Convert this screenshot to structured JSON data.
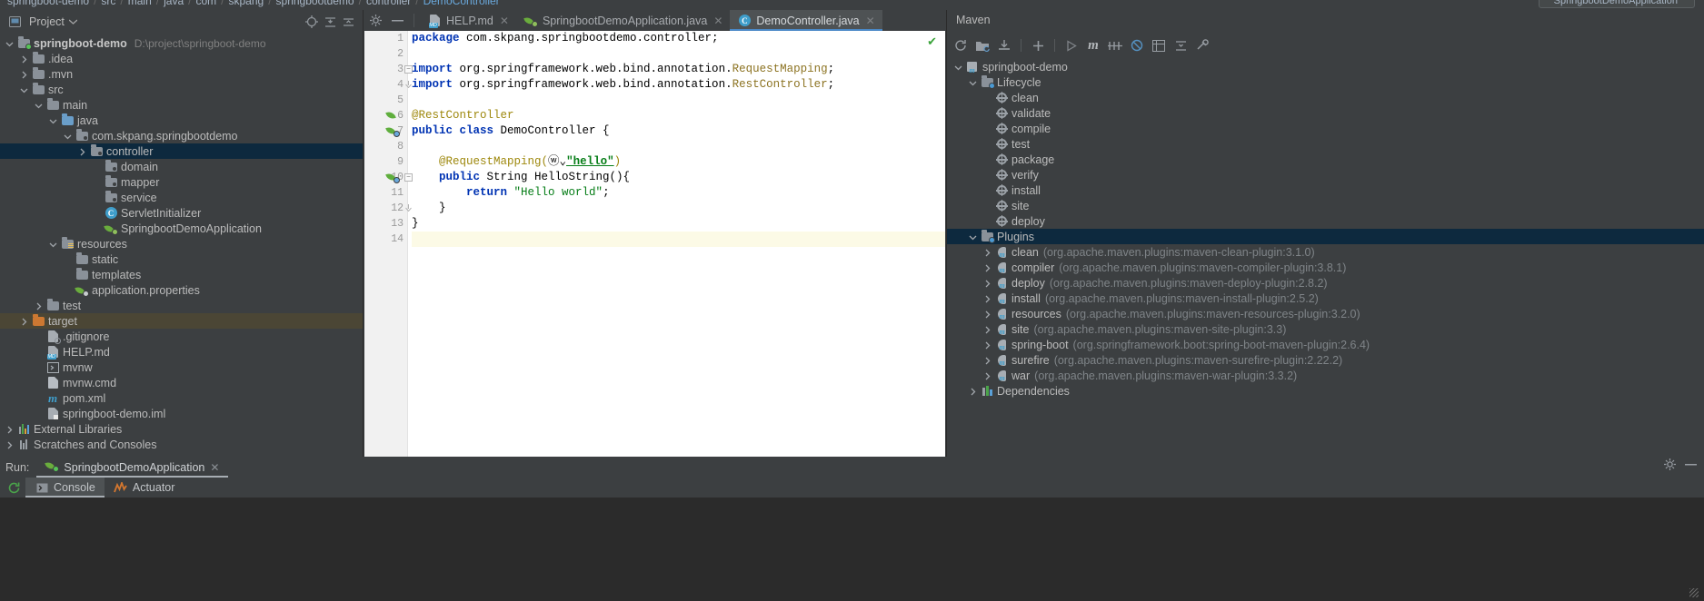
{
  "breadcrumb": {
    "items": [
      "springboot-demo",
      "src",
      "main",
      "java",
      "com",
      "skpang",
      "springbootdemo",
      "controller",
      "DemoController"
    ],
    "separator": "/"
  },
  "top_right": {
    "run_config": "SpringbootDemoApplication"
  },
  "project_panel": {
    "title": "Project",
    "icons": [
      "locate-icon",
      "expand-all-icon",
      "collapse-all-icon",
      "settings-icon",
      "hide-icon"
    ],
    "tree": [
      {
        "label": "springboot-demo",
        "path": "D:\\project\\springboot-demo",
        "depth": 0,
        "arrow": "down",
        "icon": "module-folder-icon",
        "bold": true
      },
      {
        "label": ".idea",
        "depth": 1,
        "arrow": "right",
        "icon": "folder-icon"
      },
      {
        "label": ".mvn",
        "depth": 1,
        "arrow": "right",
        "icon": "folder-icon"
      },
      {
        "label": "src",
        "depth": 1,
        "arrow": "down",
        "icon": "folder-icon"
      },
      {
        "label": "main",
        "depth": 2,
        "arrow": "down",
        "icon": "folder-icon"
      },
      {
        "label": "java",
        "depth": 3,
        "arrow": "down",
        "icon": "source-folder-icon"
      },
      {
        "label": "com.skpang.springbootdemo",
        "depth": 4,
        "arrow": "down",
        "icon": "package-icon"
      },
      {
        "label": "controller",
        "depth": 5,
        "arrow": "right",
        "icon": "package-icon",
        "selected": true
      },
      {
        "label": "domain",
        "depth": 6,
        "arrow": "none",
        "icon": "package-icon"
      },
      {
        "label": "mapper",
        "depth": 6,
        "arrow": "none",
        "icon": "package-icon"
      },
      {
        "label": "service",
        "depth": 6,
        "arrow": "none",
        "icon": "package-icon"
      },
      {
        "label": "ServletInitializer",
        "depth": 6,
        "arrow": "none",
        "icon": "java-class-icon"
      },
      {
        "label": "SpringbootDemoApplication",
        "depth": 6,
        "arrow": "none",
        "icon": "spring-boot-class-icon"
      },
      {
        "label": "resources",
        "depth": 3,
        "arrow": "down",
        "icon": "resource-folder-icon"
      },
      {
        "label": "static",
        "depth": 4,
        "arrow": "none",
        "icon": "folder-icon"
      },
      {
        "label": "templates",
        "depth": 4,
        "arrow": "none",
        "icon": "folder-icon"
      },
      {
        "label": "application.properties",
        "depth": 4,
        "arrow": "none",
        "icon": "spring-properties-icon"
      },
      {
        "label": "test",
        "depth": 2,
        "arrow": "right",
        "icon": "folder-icon"
      },
      {
        "label": "target",
        "depth": 1,
        "arrow": "right",
        "icon": "excluded-folder-icon",
        "highlighted": true
      },
      {
        "label": ".gitignore",
        "depth": 2,
        "arrow": "none",
        "icon": "gitignore-file-icon"
      },
      {
        "label": "HELP.md",
        "depth": 2,
        "arrow": "none",
        "icon": "markdown-file-icon"
      },
      {
        "label": "mvnw",
        "depth": 2,
        "arrow": "none",
        "icon": "shell-script-icon"
      },
      {
        "label": "mvnw.cmd",
        "depth": 2,
        "arrow": "none",
        "icon": "cmd-file-icon"
      },
      {
        "label": "pom.xml",
        "depth": 2,
        "arrow": "none",
        "icon": "maven-pom-icon"
      },
      {
        "label": "springboot-demo.iml",
        "depth": 2,
        "arrow": "none",
        "icon": "iml-file-icon"
      },
      {
        "label": "External Libraries",
        "depth": 0,
        "arrow": "right",
        "icon": "libraries-icon"
      },
      {
        "label": "Scratches and Consoles",
        "depth": 0,
        "arrow": "right",
        "icon": "scratches-icon"
      }
    ]
  },
  "editor": {
    "tabs": [
      {
        "label": "HELP.md",
        "icon": "markdown-file-icon",
        "active": false,
        "closable": true
      },
      {
        "label": "SpringbootDemoApplication.java",
        "icon": "spring-boot-class-icon",
        "active": false,
        "closable": true
      },
      {
        "label": "DemoController.java",
        "icon": "java-class-icon",
        "active": true,
        "closable": true
      }
    ],
    "inspection_status": "ok-check-icon",
    "lines": [
      {
        "n": 1,
        "tokens": [
          {
            "t": "package",
            "c": "kw"
          },
          {
            "t": " com.skpang.springbootdemo.controller;",
            "c": "plain"
          }
        ]
      },
      {
        "n": 2,
        "tokens": []
      },
      {
        "n": 3,
        "fold": "minus",
        "tokens": [
          {
            "t": "import",
            "c": "kw"
          },
          {
            "t": " org.springframework.web.bind.annotation.",
            "c": "plain"
          },
          {
            "t": "RequestMapping",
            "c": "cls-ref"
          },
          {
            "t": ";",
            "c": "plain"
          }
        ]
      },
      {
        "n": 4,
        "fold": "end",
        "tokens": [
          {
            "t": "import",
            "c": "kw"
          },
          {
            "t": " org.springframework.web.bind.annotation.",
            "c": "plain"
          },
          {
            "t": "RestController",
            "c": "cls-ref"
          },
          {
            "t": ";",
            "c": "plain"
          }
        ]
      },
      {
        "n": 5,
        "tokens": []
      },
      {
        "n": 6,
        "gutter_icon": "spring-bean-icon",
        "tokens": [
          {
            "t": "@RestController",
            "c": "ann"
          }
        ]
      },
      {
        "n": 7,
        "gutter_icon": "spring-boot-class-icon",
        "tokens": [
          {
            "t": "public class",
            "c": "kw"
          },
          {
            "t": " DemoController {",
            "c": "plain"
          }
        ]
      },
      {
        "n": 8,
        "tokens": []
      },
      {
        "n": 9,
        "tokens": [
          {
            "t": "    @RequestMapping(",
            "c": "ann"
          },
          {
            "t": "ⓦ⌄",
            "c": "plain"
          },
          {
            "t": "\"hello\"",
            "c": "url"
          },
          {
            "t": ")",
            "c": "ann"
          }
        ]
      },
      {
        "n": 10,
        "gutter_icon": "spring-request-icon",
        "fold": "minus",
        "tokens": [
          {
            "t": "    ",
            "c": "plain"
          },
          {
            "t": "public",
            "c": "kw"
          },
          {
            "t": " String HelloString(){",
            "c": "plain"
          }
        ]
      },
      {
        "n": 11,
        "tokens": [
          {
            "t": "        ",
            "c": "plain"
          },
          {
            "t": "return",
            "c": "kw"
          },
          {
            "t": " ",
            "c": "plain"
          },
          {
            "t": "\"Hello world\"",
            "c": "str"
          },
          {
            "t": ";",
            "c": "plain"
          }
        ]
      },
      {
        "n": 12,
        "fold": "end",
        "tokens": [
          {
            "t": "    }",
            "c": "plain"
          }
        ]
      },
      {
        "n": 13,
        "tokens": [
          {
            "t": "}",
            "c": "plain"
          }
        ]
      },
      {
        "n": 14,
        "current": true,
        "tokens": []
      }
    ]
  },
  "maven_panel": {
    "title": "Maven",
    "toolbar_icons": [
      "reload-icon",
      "add-maven-project-icon",
      "download-sources-icon",
      "add-icon",
      "run-icon",
      "execute-goal-icon",
      "toggle-skip-tests-icon",
      "toggle-offline-icon",
      "show-dependencies-icon",
      "expand-all-icon",
      "collapse-all-icon",
      "settings-icon"
    ],
    "tree": [
      {
        "label": "springboot-demo",
        "depth": 0,
        "arrow": "down",
        "icon": "maven-project-icon"
      },
      {
        "label": "Lifecycle",
        "depth": 1,
        "arrow": "down",
        "icon": "lifecycle-folder-icon"
      },
      {
        "label": "clean",
        "depth": 2,
        "arrow": "none",
        "icon": "maven-goal-icon"
      },
      {
        "label": "validate",
        "depth": 2,
        "arrow": "none",
        "icon": "maven-goal-icon"
      },
      {
        "label": "compile",
        "depth": 2,
        "arrow": "none",
        "icon": "maven-goal-icon"
      },
      {
        "label": "test",
        "depth": 2,
        "arrow": "none",
        "icon": "maven-goal-icon"
      },
      {
        "label": "package",
        "depth": 2,
        "arrow": "none",
        "icon": "maven-goal-icon"
      },
      {
        "label": "verify",
        "depth": 2,
        "arrow": "none",
        "icon": "maven-goal-icon"
      },
      {
        "label": "install",
        "depth": 2,
        "arrow": "none",
        "icon": "maven-goal-icon"
      },
      {
        "label": "site",
        "depth": 2,
        "arrow": "none",
        "icon": "maven-goal-icon"
      },
      {
        "label": "deploy",
        "depth": 2,
        "arrow": "none",
        "icon": "maven-goal-icon"
      },
      {
        "label": "Plugins",
        "depth": 1,
        "arrow": "down",
        "icon": "plugins-folder-icon",
        "selected": true
      },
      {
        "label": "clean",
        "detail": "(org.apache.maven.plugins:maven-clean-plugin:3.1.0)",
        "depth": 2,
        "arrow": "right",
        "icon": "maven-plugin-icon"
      },
      {
        "label": "compiler",
        "detail": "(org.apache.maven.plugins:maven-compiler-plugin:3.8.1)",
        "depth": 2,
        "arrow": "right",
        "icon": "maven-plugin-icon"
      },
      {
        "label": "deploy",
        "detail": "(org.apache.maven.plugins:maven-deploy-plugin:2.8.2)",
        "depth": 2,
        "arrow": "right",
        "icon": "maven-plugin-icon"
      },
      {
        "label": "install",
        "detail": "(org.apache.maven.plugins:maven-install-plugin:2.5.2)",
        "depth": 2,
        "arrow": "right",
        "icon": "maven-plugin-icon"
      },
      {
        "label": "resources",
        "detail": "(org.apache.maven.plugins:maven-resources-plugin:3.2.0)",
        "depth": 2,
        "arrow": "right",
        "icon": "maven-plugin-icon"
      },
      {
        "label": "site",
        "detail": "(org.apache.maven.plugins:maven-site-plugin:3.3)",
        "depth": 2,
        "arrow": "right",
        "icon": "maven-plugin-icon"
      },
      {
        "label": "spring-boot",
        "detail": "(org.springframework.boot:spring-boot-maven-plugin:2.6.4)",
        "depth": 2,
        "arrow": "right",
        "icon": "maven-plugin-icon"
      },
      {
        "label": "surefire",
        "detail": "(org.apache.maven.plugins:maven-surefire-plugin:2.22.2)",
        "depth": 2,
        "arrow": "right",
        "icon": "maven-plugin-icon"
      },
      {
        "label": "war",
        "detail": "(org.apache.maven.plugins:maven-war-plugin:3.3.2)",
        "depth": 2,
        "arrow": "right",
        "icon": "maven-plugin-icon"
      },
      {
        "label": "Dependencies",
        "depth": 1,
        "arrow": "right",
        "icon": "dependencies-icon"
      }
    ]
  },
  "run_panel": {
    "label": "Run:",
    "tab": "SpringbootDemoApplication",
    "console_tabs": [
      {
        "label": "Console",
        "icon": "console-icon",
        "active": true
      },
      {
        "label": "Actuator",
        "icon": "actuator-icon",
        "active": false
      }
    ],
    "rerun_icon": "rerun-icon",
    "right_icons": [
      "settings-icon",
      "hide-icon"
    ]
  },
  "colors": {
    "panel_bg": "#3c3f41",
    "editor_bg": "#ffffff",
    "selection": "#0d293e",
    "tab_active": "#4e5254",
    "accent_blue": "#4a88c7",
    "target_highlight": "#4b4635",
    "current_line": "#fcfae6"
  }
}
